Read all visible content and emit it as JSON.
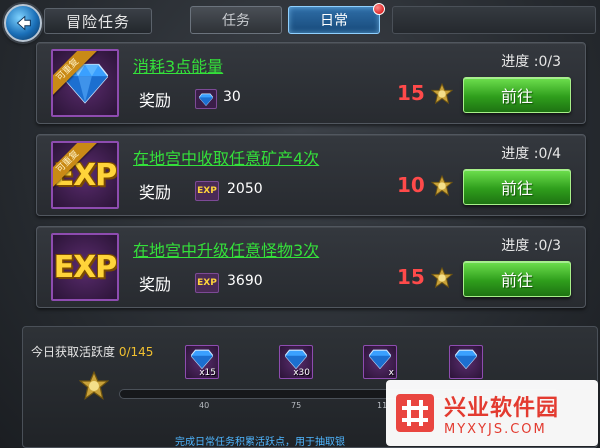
{
  "header": {
    "title": "冒险任务",
    "tabs": [
      {
        "label": "任务",
        "active": false
      },
      {
        "label": "日常",
        "active": true,
        "has_notification": true
      }
    ]
  },
  "tasks": [
    {
      "badge": "可重复",
      "icon": "gem-icon",
      "title": "消耗3点能量",
      "progress": "进度 :0/3",
      "reward_label": "奖励",
      "reward_icon": "gem-icon",
      "reward_value": "30",
      "points": "15",
      "button": "前往"
    },
    {
      "badge": "可重复",
      "icon": "exp-icon",
      "icon_text": "EXP",
      "title": "在地宫中收取任意矿产4次",
      "progress": "进度 :0/4",
      "reward_label": "奖励",
      "reward_icon": "exp-icon",
      "reward_icon_text": "EXP",
      "reward_value": "2050",
      "points": "10",
      "button": "前往"
    },
    {
      "badge": "",
      "icon": "exp-icon",
      "icon_text": "EXP",
      "title": "在地宫中升级任意怪物3次",
      "progress": "进度 :0/3",
      "reward_label": "奖励",
      "reward_icon": "exp-icon",
      "reward_icon_text": "EXP",
      "reward_value": "3690",
      "points": "15",
      "button": "前往"
    }
  ],
  "activity": {
    "label": "今日获取活跃度",
    "value": "0/145",
    "progress_fraction": 0.0,
    "milestones": [
      {
        "qty": "x15",
        "tick": "40"
      },
      {
        "qty": "x30",
        "tick": "75"
      },
      {
        "qty": "x",
        "tick": "11"
      },
      {
        "qty": "",
        "tick": ""
      }
    ],
    "footer": "完成日常任务积累活跃点，用于抽取银"
  },
  "watermark": {
    "name": "兴业软件园",
    "url": "MYXYJS.COM"
  },
  "colors": {
    "task_title": "#34e03a",
    "points": "#ff4a4a",
    "go_button": "#2f9e1c",
    "active_tab": "#2f6ea8",
    "notification": "#d10000"
  }
}
